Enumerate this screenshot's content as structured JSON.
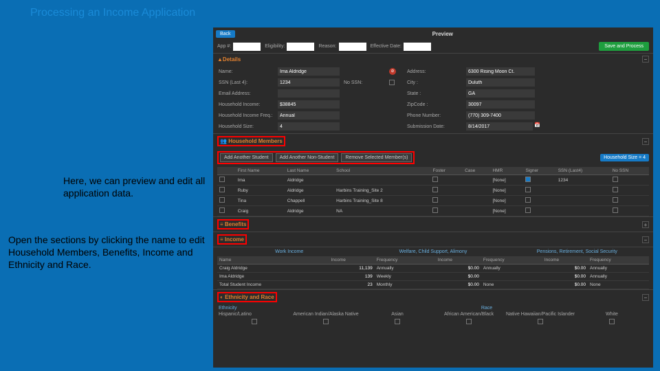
{
  "slide": {
    "title": "Processing an Income Application",
    "caption1": "Here, we can preview and edit all application data.",
    "caption2": "Open the sections by clicking the name to edit Household Members, Benefits, Income and Ethnicity and Race."
  },
  "topbar": {
    "back": "Back",
    "tab": "Preview"
  },
  "filters": {
    "app_label": "App #:",
    "elig_label": "Eligibility:",
    "reason_label": "Reason:",
    "eff_label": "Effective Date:",
    "save": "Save and Process"
  },
  "details": {
    "header": "Details",
    "name_label": "Name:",
    "name": "Ima Aldridge",
    "ssn_label": "SSN (Last 4):",
    "ssn": "1234",
    "nossn_label": "No SSN:",
    "email_label": "Email Address:",
    "email": "",
    "hinc_label": "Household Income:",
    "hinc": "$38845",
    "hfreq_label": "Household Income Freq.:",
    "hfreq": "Annual",
    "hsize_label": "Household Size:",
    "hsize": "4",
    "addr_label": "Address:",
    "addr": "6300 Rising Moon Ct.",
    "city_label": "City :",
    "city": "Duluth",
    "state_label": "State :",
    "state": "GA",
    "zip_label": "ZipCode :",
    "zip": "30097",
    "phone_label": "Phone Number:",
    "phone": "(770) 309-7400",
    "sub_label": "Submission Date:",
    "sub": "8/14/2017"
  },
  "members": {
    "header": "Household Members",
    "add_student": "Add Another Student",
    "add_non": "Add Another Non-Student",
    "remove": "Remove Selected Member(s)",
    "count": "Household Size = 4",
    "cols": [
      "",
      "First Name",
      "Last Name",
      "School",
      "Foster",
      "Case",
      "HMR",
      "Signer",
      "SSN (Last4)",
      "No SSN"
    ],
    "rows": [
      {
        "first": "Ima",
        "last": "Aldridge",
        "school": "",
        "foster": false,
        "case": "",
        "hmr": "[None]",
        "signer": true,
        "ssn": "1234",
        "nossn": false
      },
      {
        "first": "Ruby",
        "last": "Aldridge",
        "school": "Harbins Training_Site 2",
        "foster": false,
        "case": "",
        "hmr": "[None]",
        "signer": false,
        "ssn": "",
        "nossn": false
      },
      {
        "first": "Tina",
        "last": "Chappell",
        "school": "Harbins Training_Site 8",
        "foster": false,
        "case": "",
        "hmr": "[None]",
        "signer": false,
        "ssn": "",
        "nossn": false
      },
      {
        "first": "Craig",
        "last": "Aldridge",
        "school": "NA",
        "foster": false,
        "case": "",
        "hmr": "[None]",
        "signer": false,
        "ssn": "",
        "nossn": false
      }
    ]
  },
  "benefits": {
    "header": "Benefits"
  },
  "income": {
    "header": "Income",
    "groups": [
      "Work Income",
      "Welfare, Child Support, Alimony",
      "Pensions, Retirement, Social Security"
    ],
    "cols": [
      "Name",
      "Income",
      "Frequency",
      "Income",
      "Frequency",
      "Income",
      "Frequency"
    ],
    "rows": [
      {
        "name": "Craig Aldridge",
        "v": [
          "11,139",
          "Annually",
          "$0.00",
          "Annually",
          "$0.00",
          "Annually"
        ]
      },
      {
        "name": "Ima Aldridge",
        "v": [
          "139",
          "Weekly",
          "$0.00",
          "",
          "$0.00",
          "Annually"
        ]
      },
      {
        "name": "Total Student Income",
        "v": [
          "23",
          "Monthly",
          "$0.00",
          "None",
          "$0.00",
          "None"
        ]
      }
    ]
  },
  "ethrace": {
    "header": "Ethnicity and Race",
    "eth_label": "Ethnicity",
    "race_label": "Race",
    "eth_opt": "Hispanic/Latino",
    "race_opts": [
      "American Indian/Alaska Native",
      "Asian",
      "African American/Black",
      "Native Hawaiian/Pacific Islander",
      "White"
    ]
  }
}
